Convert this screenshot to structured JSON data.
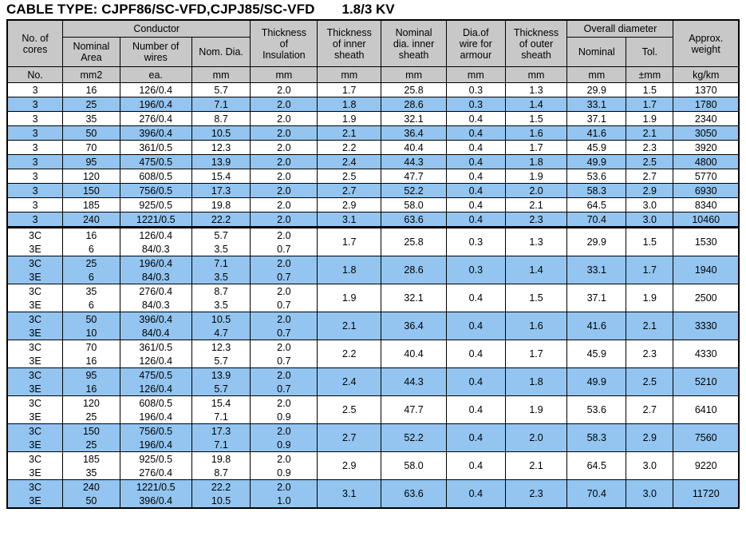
{
  "title": {
    "cable_type": "CABLE TYPE: CJPF86/SC-VFD,CJPJ85/SC-VFD",
    "voltage": "1.8/3 KV"
  },
  "header": {
    "group_conductor": "Conductor",
    "group_overall_diameter": "Overall diameter",
    "col_no_of_cores": "No. of\ncores",
    "col_nominal_area": "Nominal\nArea",
    "col_number_of_wires": "Number of\nwires",
    "col_nom_dia": "Nom. Dia.",
    "col_thickness_of_insulation": "Thickness\nof\nInsulation",
    "col_thickness_of_inner_sheath": "Thickness\nof inner\nsheath",
    "col_nominal_dia_inner_sheath": "Nominal\ndia. inner\nsheath",
    "col_dia_of_wire_for_armour": "Dia.of\nwire for\narmour",
    "col_thickness_of_outer_sheath": "Thickness\nof outer\nsheath",
    "col_overall_nominal": "Nominal",
    "col_overall_tol": "Tol.",
    "col_approx_weight": "Approx.\nweight"
  },
  "units": {
    "cores": "No.",
    "nominal_area": "mm2",
    "number_of_wires": "ea.",
    "nom_dia": "mm",
    "thickness_insulation": "mm",
    "thickness_inner_sheath": "mm",
    "nominal_dia_inner_sheath": "mm",
    "dia_wire_armour": "mm",
    "thickness_outer_sheath": "mm",
    "overall_nominal": "mm",
    "overall_tol": "±mm",
    "approx_weight": "kg/km"
  },
  "colors": {
    "header_gray": "#c8c8c8",
    "row_blue": "#93c5f0",
    "row_white": "#ffffff",
    "border": "#000000"
  },
  "chart_data": {
    "type": "table",
    "title": "CABLE TYPE: CJPF86/SC-VFD,CJPJ85/SC-VFD 1.8/3 KV",
    "columns": [
      "No. of cores",
      "Conductor Nominal Area (mm2)",
      "Conductor Number of wires (ea.)",
      "Conductor Nom. Dia. (mm)",
      "Thickness of Insulation (mm)",
      "Thickness of inner sheath (mm)",
      "Nominal dia. inner sheath (mm)",
      "Dia.of wire for armour (mm)",
      "Thickness of outer sheath (mm)",
      "Overall diameter Nominal (mm)",
      "Overall diameter Tol. (±mm)",
      "Approx. weight (kg/km)"
    ]
  },
  "section_single": {
    "rows": [
      {
        "cores": "3",
        "area": "16",
        "wires": "126/0.4",
        "nomdia": "5.7",
        "ins": "2.0",
        "inner": "1.7",
        "nomdia_inner": "25.8",
        "armour": "0.3",
        "outer": "1.3",
        "od_nom": "29.9",
        "od_tol": "1.5",
        "weight": "1370",
        "shade": false
      },
      {
        "cores": "3",
        "area": "25",
        "wires": "196/0.4",
        "nomdia": "7.1",
        "ins": "2.0",
        "inner": "1.8",
        "nomdia_inner": "28.6",
        "armour": "0.3",
        "outer": "1.4",
        "od_nom": "33.1",
        "od_tol": "1.7",
        "weight": "1780",
        "shade": true
      },
      {
        "cores": "3",
        "area": "35",
        "wires": "276/0.4",
        "nomdia": "8.7",
        "ins": "2.0",
        "inner": "1.9",
        "nomdia_inner": "32.1",
        "armour": "0.4",
        "outer": "1.5",
        "od_nom": "37.1",
        "od_tol": "1.9",
        "weight": "2340",
        "shade": false
      },
      {
        "cores": "3",
        "area": "50",
        "wires": "396/0.4",
        "nomdia": "10.5",
        "ins": "2.0",
        "inner": "2.1",
        "nomdia_inner": "36.4",
        "armour": "0.4",
        "outer": "1.6",
        "od_nom": "41.6",
        "od_tol": "2.1",
        "weight": "3050",
        "shade": true
      },
      {
        "cores": "3",
        "area": "70",
        "wires": "361/0.5",
        "nomdia": "12.3",
        "ins": "2.0",
        "inner": "2.2",
        "nomdia_inner": "40.4",
        "armour": "0.4",
        "outer": "1.7",
        "od_nom": "45.9",
        "od_tol": "2.3",
        "weight": "3920",
        "shade": false
      },
      {
        "cores": "3",
        "area": "95",
        "wires": "475/0.5",
        "nomdia": "13.9",
        "ins": "2.0",
        "inner": "2.4",
        "nomdia_inner": "44.3",
        "armour": "0.4",
        "outer": "1.8",
        "od_nom": "49.9",
        "od_tol": "2.5",
        "weight": "4800",
        "shade": true
      },
      {
        "cores": "3",
        "area": "120",
        "wires": "608/0.5",
        "nomdia": "15.4",
        "ins": "2.0",
        "inner": "2.5",
        "nomdia_inner": "47.7",
        "armour": "0.4",
        "outer": "1.9",
        "od_nom": "53.6",
        "od_tol": "2.7",
        "weight": "5770",
        "shade": false
      },
      {
        "cores": "3",
        "area": "150",
        "wires": "756/0.5",
        "nomdia": "17.3",
        "ins": "2.0",
        "inner": "2.7",
        "nomdia_inner": "52.2",
        "armour": "0.4",
        "outer": "2.0",
        "od_nom": "58.3",
        "od_tol": "2.9",
        "weight": "6930",
        "shade": true
      },
      {
        "cores": "3",
        "area": "185",
        "wires": "925/0.5",
        "nomdia": "19.8",
        "ins": "2.0",
        "inner": "2.9",
        "nomdia_inner": "58.0",
        "armour": "0.4",
        "outer": "2.1",
        "od_nom": "64.5",
        "od_tol": "3.0",
        "weight": "8340",
        "shade": false
      },
      {
        "cores": "3",
        "area": "240",
        "wires": "1221/0.5",
        "nomdia": "22.2",
        "ins": "2.0",
        "inner": "3.1",
        "nomdia_inner": "63.6",
        "armour": "0.4",
        "outer": "2.3",
        "od_nom": "70.4",
        "od_tol": "3.0",
        "weight": "10460",
        "shade": true
      }
    ]
  },
  "section_pair": {
    "rows": [
      {
        "top": {
          "cores": "3C",
          "area": "16",
          "wires": "126/0.4",
          "nomdia": "5.7",
          "ins": "2.0"
        },
        "bot": {
          "cores": "3E",
          "area": "6",
          "wires": "84/0.3",
          "nomdia": "3.5",
          "ins": "0.7"
        },
        "inner": "1.7",
        "nomdia_inner": "25.8",
        "armour": "0.3",
        "outer": "1.3",
        "od_nom": "29.9",
        "od_tol": "1.5",
        "weight": "1530",
        "shade": false
      },
      {
        "top": {
          "cores": "3C",
          "area": "25",
          "wires": "196/0.4",
          "nomdia": "7.1",
          "ins": "2.0"
        },
        "bot": {
          "cores": "3E",
          "area": "6",
          "wires": "84/0.3",
          "nomdia": "3.5",
          "ins": "0.7"
        },
        "inner": "1.8",
        "nomdia_inner": "28.6",
        "armour": "0.3",
        "outer": "1.4",
        "od_nom": "33.1",
        "od_tol": "1.7",
        "weight": "1940",
        "shade": true
      },
      {
        "top": {
          "cores": "3C",
          "area": "35",
          "wires": "276/0.4",
          "nomdia": "8.7",
          "ins": "2.0"
        },
        "bot": {
          "cores": "3E",
          "area": "6",
          "wires": "84/0.3",
          "nomdia": "3.5",
          "ins": "0.7"
        },
        "inner": "1.9",
        "nomdia_inner": "32.1",
        "armour": "0.4",
        "outer": "1.5",
        "od_nom": "37.1",
        "od_tol": "1.9",
        "weight": "2500",
        "shade": false
      },
      {
        "top": {
          "cores": "3C",
          "area": "50",
          "wires": "396/0.4",
          "nomdia": "10.5",
          "ins": "2.0"
        },
        "bot": {
          "cores": "3E",
          "area": "10",
          "wires": "84/0.4",
          "nomdia": "4.7",
          "ins": "0.7"
        },
        "inner": "2.1",
        "nomdia_inner": "36.4",
        "armour": "0.4",
        "outer": "1.6",
        "od_nom": "41.6",
        "od_tol": "2.1",
        "weight": "3330",
        "shade": true
      },
      {
        "top": {
          "cores": "3C",
          "area": "70",
          "wires": "361/0.5",
          "nomdia": "12.3",
          "ins": "2.0"
        },
        "bot": {
          "cores": "3E",
          "area": "16",
          "wires": "126/0.4",
          "nomdia": "5.7",
          "ins": "0.7"
        },
        "inner": "2.2",
        "nomdia_inner": "40.4",
        "armour": "0.4",
        "outer": "1.7",
        "od_nom": "45.9",
        "od_tol": "2.3",
        "weight": "4330",
        "shade": false
      },
      {
        "top": {
          "cores": "3C",
          "area": "95",
          "wires": "475/0.5",
          "nomdia": "13.9",
          "ins": "2.0"
        },
        "bot": {
          "cores": "3E",
          "area": "16",
          "wires": "126/0.4",
          "nomdia": "5.7",
          "ins": "0.7"
        },
        "inner": "2.4",
        "nomdia_inner": "44.3",
        "armour": "0.4",
        "outer": "1.8",
        "od_nom": "49.9",
        "od_tol": "2.5",
        "weight": "5210",
        "shade": true
      },
      {
        "top": {
          "cores": "3C",
          "area": "120",
          "wires": "608/0.5",
          "nomdia": "15.4",
          "ins": "2.0"
        },
        "bot": {
          "cores": "3E",
          "area": "25",
          "wires": "196/0.4",
          "nomdia": "7.1",
          "ins": "0.9"
        },
        "inner": "2.5",
        "nomdia_inner": "47.7",
        "armour": "0.4",
        "outer": "1.9",
        "od_nom": "53.6",
        "od_tol": "2.7",
        "weight": "6410",
        "shade": false
      },
      {
        "top": {
          "cores": "3C",
          "area": "150",
          "wires": "756/0.5",
          "nomdia": "17.3",
          "ins": "2.0"
        },
        "bot": {
          "cores": "3E",
          "area": "25",
          "wires": "196/0.4",
          "nomdia": "7.1",
          "ins": "0.9"
        },
        "inner": "2.7",
        "nomdia_inner": "52.2",
        "armour": "0.4",
        "outer": "2.0",
        "od_nom": "58.3",
        "od_tol": "2.9",
        "weight": "7560",
        "shade": true
      },
      {
        "top": {
          "cores": "3C",
          "area": "185",
          "wires": "925/0.5",
          "nomdia": "19.8",
          "ins": "2.0"
        },
        "bot": {
          "cores": "3E",
          "area": "35",
          "wires": "276/0.4",
          "nomdia": "8.7",
          "ins": "0.9"
        },
        "inner": "2.9",
        "nomdia_inner": "58.0",
        "armour": "0.4",
        "outer": "2.1",
        "od_nom": "64.5",
        "od_tol": "3.0",
        "weight": "9220",
        "shade": false
      },
      {
        "top": {
          "cores": "3C",
          "area": "240",
          "wires": "1221/0.5",
          "nomdia": "22.2",
          "ins": "2.0"
        },
        "bot": {
          "cores": "3E",
          "area": "50",
          "wires": "396/0.4",
          "nomdia": "10.5",
          "ins": "1.0"
        },
        "inner": "3.1",
        "nomdia_inner": "63.6",
        "armour": "0.4",
        "outer": "2.3",
        "od_nom": "70.4",
        "od_tol": "3.0",
        "weight": "11720",
        "shade": true
      }
    ]
  }
}
